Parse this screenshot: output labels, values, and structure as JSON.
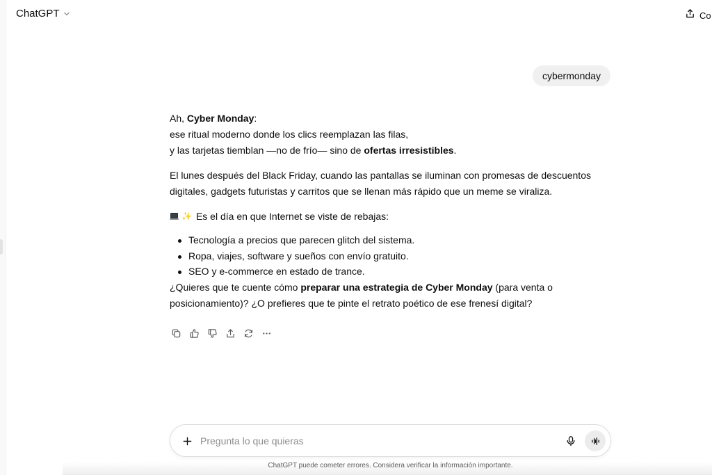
{
  "header": {
    "model_name": "ChatGPT",
    "share_label": "Co"
  },
  "conversation": {
    "user_message": "cybermonday",
    "answer": {
      "line1_prefix": "Ah, ",
      "line1_bold": "Cyber Monday",
      "line1_suffix": ":",
      "line2": "ese ritual moderno donde los clics reemplazan las filas,",
      "line3_prefix": "y las tarjetas tiemblan —no de frío— sino de ",
      "line3_bold": "ofertas irresistibles",
      "line3_suffix": ".",
      "para2": "El lunes después del Black Friday, cuando las pantallas se iluminan con promesas de descuentos digitales, gadgets futuristas y carritos que se llenan más rápido que un meme se viraliza.",
      "intro_line": "Es el día en que Internet se viste de rebajas:",
      "bullets": [
        "Tecnología a precios que parecen glitch del sistema.",
        "Ropa, viajes, software y sueños con envío gratuito.",
        "SEO y e-commerce en estado de trance."
      ],
      "closing_prefix": "¿Quieres que te cuente cómo ",
      "closing_bold": "preparar una estrategia de Cyber Monday",
      "closing_suffix": " (para venta o posicionamiento)? ¿O prefieres que te pinte el retrato poético de ese frenesí digital?"
    },
    "action_icons": [
      "copy-icon",
      "thumbs-up-icon",
      "thumbs-down-icon",
      "share-icon",
      "regenerate-icon",
      "more-icon"
    ]
  },
  "composer": {
    "placeholder": "Pregunta lo que quieras",
    "value": ""
  },
  "footer": {
    "disclaimer": "ChatGPT puede cometer errores. Considera verificar la información importante."
  }
}
